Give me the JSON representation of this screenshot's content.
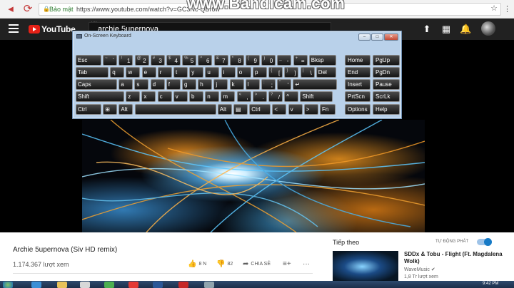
{
  "browser": {
    "secure_label": "Bảo mật",
    "url": "https://www.youtube.com/watch?v=GC3Nc-QBr6w",
    "watermark": "www.Bandicam.com"
  },
  "youtube": {
    "logo_text": "YouTube",
    "logo_region": "VN",
    "search_value": "archie 5upernova"
  },
  "osk": {
    "title": "On-Screen Keyboard",
    "rows": [
      [
        {
          "main": "Esc"
        },
        {
          "sub": "~",
          "main": "`"
        },
        {
          "sub": "!",
          "main": "1"
        },
        {
          "sub": "@",
          "main": "2"
        },
        {
          "sub": "#",
          "main": "3"
        },
        {
          "sub": "$",
          "main": "4"
        },
        {
          "sub": "%",
          "main": "5"
        },
        {
          "sub": "^",
          "main": "6"
        },
        {
          "sub": "&",
          "main": "7"
        },
        {
          "sub": "*",
          "main": "8"
        },
        {
          "sub": "(",
          "main": "9"
        },
        {
          "sub": ")",
          "main": "0"
        },
        {
          "sub": "_",
          "main": "-"
        },
        {
          "sub": "+",
          "main": "="
        },
        {
          "main": "Bksp"
        }
      ],
      [
        {
          "main": "Tab"
        },
        {
          "main": "q"
        },
        {
          "main": "w"
        },
        {
          "main": "e"
        },
        {
          "main": "r"
        },
        {
          "main": "t"
        },
        {
          "main": "y"
        },
        {
          "main": "u"
        },
        {
          "main": "i"
        },
        {
          "main": "o"
        },
        {
          "main": "p"
        },
        {
          "sub": "{",
          "main": "["
        },
        {
          "sub": "}",
          "main": "]"
        },
        {
          "sub": "|",
          "main": "\\"
        },
        {
          "main": "Del"
        }
      ],
      [
        {
          "main": "Caps"
        },
        {
          "main": "a"
        },
        {
          "main": "s"
        },
        {
          "main": "d"
        },
        {
          "main": "f"
        },
        {
          "main": "g"
        },
        {
          "main": "h"
        },
        {
          "main": "j"
        },
        {
          "main": "k"
        },
        {
          "main": "l"
        },
        {
          "sub": ":",
          "main": ";"
        },
        {
          "sub": "\"",
          "main": "'"
        },
        {
          "main": "↵"
        }
      ],
      [
        {
          "main": "Shift"
        },
        {
          "main": "z"
        },
        {
          "main": "x"
        },
        {
          "main": "c"
        },
        {
          "main": "v"
        },
        {
          "main": "b"
        },
        {
          "main": "n"
        },
        {
          "main": "m"
        },
        {
          "sub": "<",
          "main": ","
        },
        {
          "sub": ">",
          "main": "."
        },
        {
          "sub": "?",
          "main": "/"
        },
        {
          "main": "^"
        },
        {
          "main": "Shift"
        }
      ],
      [
        {
          "main": "Ctrl"
        },
        {
          "main": "⊞"
        },
        {
          "main": "Alt"
        },
        {
          "main": ""
        },
        {
          "main": "Alt"
        },
        {
          "main": "▤"
        },
        {
          "main": "Ctrl"
        },
        {
          "main": "<"
        },
        {
          "main": "v"
        },
        {
          "main": ">"
        },
        {
          "main": "Fn"
        }
      ]
    ],
    "side": [
      [
        "Home",
        "PgUp"
      ],
      [
        "End",
        "PgDn"
      ],
      [
        "Insert",
        "Pause"
      ],
      [
        "PrtScn",
        "ScrLk"
      ],
      [
        "Options",
        "Help"
      ]
    ]
  },
  "video": {
    "title": "Archie 5upernova (Siv HD remix)",
    "views": "1.174.367 lượt xem",
    "likes": "8 N",
    "dislikes": "82",
    "share_label": "CHIA SẺ"
  },
  "sidebar": {
    "up_next_label": "Tiếp theo",
    "autoplay_label": "TỰ ĐỘNG PHÁT",
    "autoplay_on": true,
    "recommended": {
      "title": "SDDx & Tobu - Flight (Ft. Magdalena Wolk)",
      "channel": "WaveMusic ✔",
      "views": "1,8 Tr lượt xem"
    }
  },
  "taskbar": {
    "clock": "9:42 PM"
  }
}
